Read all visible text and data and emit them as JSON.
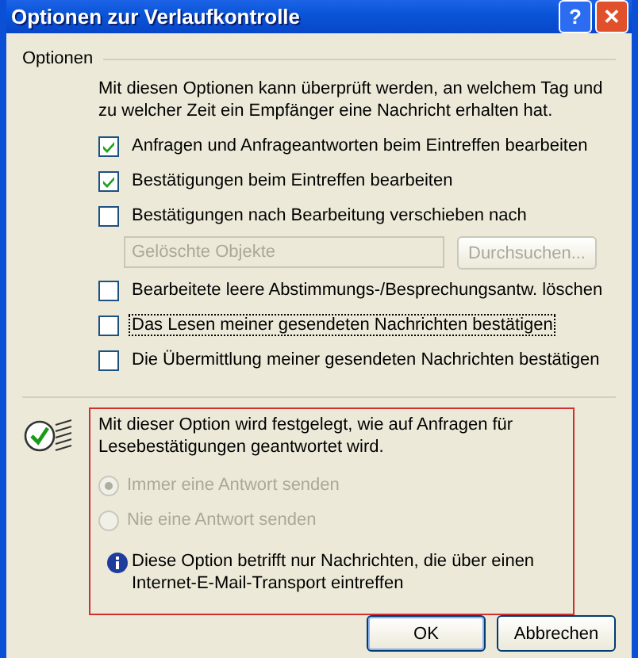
{
  "window": {
    "title": "Optionen zur Verlaufkontrolle",
    "buttons": [
      "?",
      "✕"
    ]
  },
  "group": {
    "label": "Optionen",
    "description": "Mit diesen Optionen kann überprüft werden, an welchem Tag und zu welcher Zeit ein Empfänger eine Nachricht erhalten hat.",
    "items": [
      {
        "kind": "checkbox",
        "label": "Anfragen und Anfrageantworten beim Eintreffen bearbeiten",
        "checked": true,
        "focused": false
      },
      {
        "kind": "checkbox",
        "label": "Bestätigungen beim Eintreffen bearbeiten",
        "checked": true,
        "focused": false
      },
      {
        "kind": "checkbox",
        "label": "Bestätigungen nach Bearbeitung verschieben nach",
        "checked": false,
        "focused": false
      },
      {
        "kind": "folder",
        "value": "Gelöschte Objekte",
        "button": "Durchsuchen...",
        "disabled": true
      },
      {
        "kind": "checkbox",
        "label": "Bearbeitete leere Abstimmungs-/Besprechungsantw. löschen",
        "checked": false,
        "focused": false
      },
      {
        "kind": "checkbox",
        "label": "Das Lesen meiner gesendeten Nachrichten bestätigen",
        "checked": false,
        "focused": true
      },
      {
        "kind": "checkbox",
        "label": "Die Übermittlung meiner gesendeten Nachrichten bestätigen",
        "checked": false,
        "focused": false
      }
    ]
  },
  "read_receipts": {
    "description": "Mit dieser Option wird festgelegt, wie auf Anfragen für Lesebestätigungen geantwortet wird.",
    "options": [
      {
        "label": "Immer eine Antwort senden",
        "selected": true,
        "disabled": true
      },
      {
        "label": "Nie eine Antwort senden",
        "selected": false,
        "disabled": true
      }
    ],
    "note": "Diese Option betrifft nur Nachrichten, die über einen Internet-E-Mail-Transport eintreffen"
  },
  "buttons": [
    {
      "label": "OK",
      "default": true
    },
    {
      "label": "Abbrechen",
      "default": false
    }
  ]
}
